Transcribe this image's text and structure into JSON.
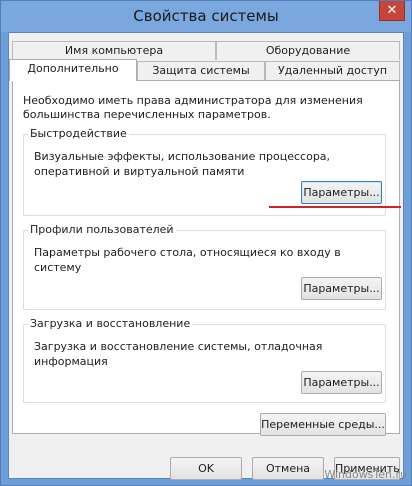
{
  "window": {
    "title": "Свойства системы",
    "close_label": "✕"
  },
  "tabs": {
    "row1": [
      "Имя компьютера",
      "Оборудование"
    ],
    "row2": [
      "Дополнительно",
      "Защита системы",
      "Удаленный доступ"
    ],
    "active": "Дополнительно"
  },
  "panel": {
    "info": "Необходимо иметь права администратора для изменения большинства перечисленных параметров.",
    "performance": {
      "title": "Быстродействие",
      "description": "Визуальные эффекты, использование процессора, оперативной и виртуальной памяти",
      "button": "Параметры..."
    },
    "profiles": {
      "title": "Профили пользователей",
      "description": "Параметры рабочего стола, относящиеся ко входу в систему",
      "button": "Параметры..."
    },
    "startup": {
      "title": "Загрузка и восстановление",
      "description": "Загрузка и восстановление системы, отладочная информация",
      "button": "Параметры..."
    },
    "env_button": "Переменные среды..."
  },
  "footer": {
    "ok": "OK",
    "cancel": "Отмена",
    "apply": "Применить"
  },
  "watermark": "WindowsTen.ru",
  "colors": {
    "frame": "#6f9ed6",
    "close": "#c7463b",
    "annotation": "#c9252b"
  }
}
